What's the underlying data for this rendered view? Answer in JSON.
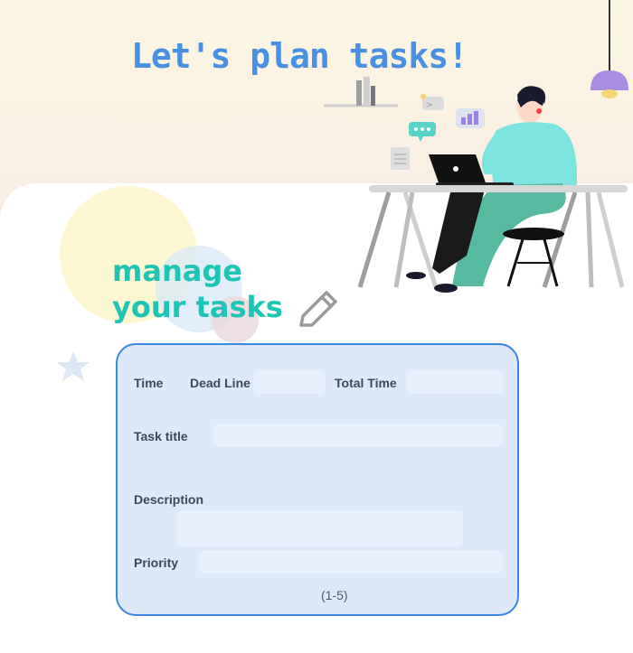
{
  "page": {
    "title": "Let's plan tasks!",
    "heading_line1": "manage",
    "heading_line2": "your tasks"
  },
  "form": {
    "time_label": "Time",
    "deadline_label": "Dead Line",
    "total_time_label": "Total Time",
    "task_title_label": "Task title",
    "description_label": "Description",
    "priority_label": "Priority",
    "priority_hint": "(1-5)"
  },
  "icons": {
    "edit": "pencil-icon",
    "illustration": "person-at-desk-illustration",
    "lamp": "pendant-lamp-icon",
    "star": "star-icon"
  },
  "colors": {
    "title": "#4a90e2",
    "heading": "#1ec5b4",
    "card_bg": "#dde9f9",
    "card_border": "#3a86e0"
  }
}
